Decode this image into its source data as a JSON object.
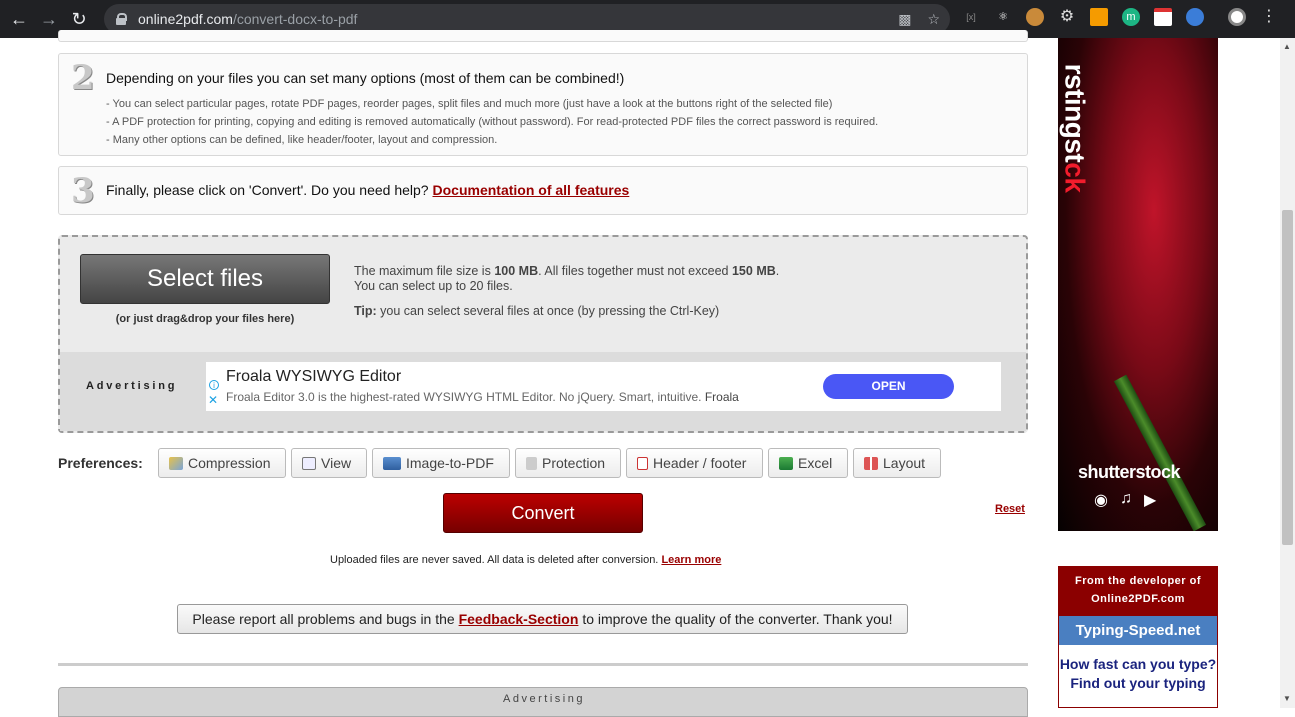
{
  "browser": {
    "url_domain": "online2pdf.com",
    "url_path": "/convert-docx-to-pdf"
  },
  "steps": {
    "step2": {
      "number": "2",
      "heading": "Depending on your files you can set many options (most of them can be combined!)",
      "lines": [
        "- You can select particular pages, rotate PDF pages, reorder pages, split files and much more (just have a look at the buttons right of the selected file)",
        "- A PDF protection for printing, copying and editing is removed automatically (without password). For read-protected PDF files the correct password is required.",
        "- Many other options can be defined, like header/footer, layout and compression."
      ]
    },
    "step3": {
      "number": "3",
      "heading": "Finally, please click on 'Convert'. Do you need help?",
      "link": "Documentation of all features"
    }
  },
  "upload": {
    "select_label": "Select files",
    "drag_hint": "(or just drag&drop your files here)",
    "max_size_prefix": "The maximum file size is",
    "max_size": "100 MB",
    "total_prefix": ". All files together must not exceed",
    "total_size": "150 MB",
    "total_suffix": ".",
    "count_info": "You can select up to 20 files.",
    "tip_label": "Tip:",
    "tip_text": " you can select several files at once (by pressing the Ctrl-Key)"
  },
  "inline_ad": {
    "label": "Advertising",
    "title": "Froala WYSIWYG Editor",
    "description": "Froala Editor 3.0 is the highest-rated WYSIWYG HTML Editor. No jQuery. Smart, intuitive.",
    "advertiser": "Froala",
    "cta": "OPEN"
  },
  "preferences": {
    "label": "Preferences:",
    "buttons": [
      "Compression",
      "View",
      "Image-to-PDF",
      "Protection",
      "Header / footer",
      "Excel",
      "Layout"
    ]
  },
  "actions": {
    "convert": "Convert",
    "reset": "Reset"
  },
  "notes": {
    "saved": "Uploaded files are never saved. All data is deleted after conversion.",
    "learn_more": "Learn more",
    "report_prefix": "Please report all problems and bugs in the",
    "report_link": "Feedback-Section",
    "report_suffix": "to improve the quality of the converter. Thank you!"
  },
  "bottom_ad": {
    "label": "Advertising"
  },
  "side_ad": {
    "vertical_text_a": "rstingst",
    "vertical_text_b": "ck",
    "brand": "shutterstock"
  },
  "developer_box": {
    "heading": "From the developer of Online2PDF.com",
    "site": "Typing-Speed.net",
    "question": "How fast can you type?",
    "cta": "Find out your typing"
  }
}
